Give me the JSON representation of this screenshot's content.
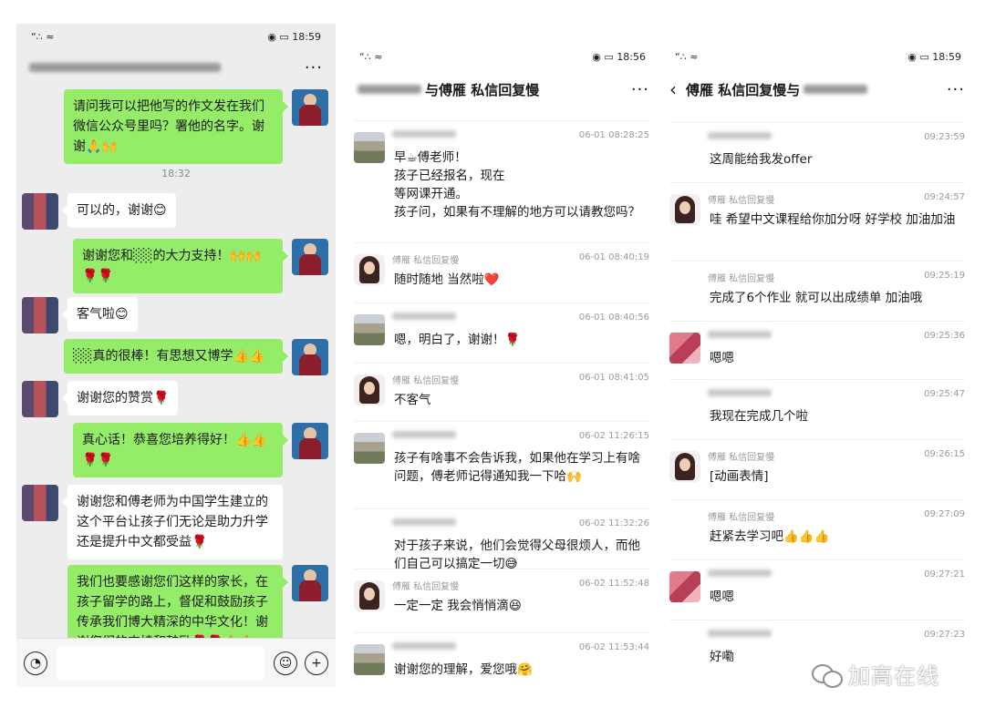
{
  "panel1": {
    "status_time": "18:59",
    "status_icons": "◉ ▭",
    "signal": "“∴ ≈",
    "more": "···",
    "time_divider": "18:32",
    "messages": [
      {
        "side": "right",
        "text": "请问我可以把他写的作文发在我们微信公众号里吗？署他的名字。谢谢🙏🙌"
      },
      {
        "side": "left",
        "text": "可以的，谢谢😊"
      },
      {
        "side": "right",
        "text": "谢谢您和░░的大力支持！🙌🙌🌹🌹"
      },
      {
        "side": "left",
        "text": "客气啦😊"
      },
      {
        "side": "right",
        "text": "░░真的很棒！有思想又博学👍👍"
      },
      {
        "side": "left",
        "text": "谢谢您的赞赏🌹"
      },
      {
        "side": "right",
        "text": "真心话！恭喜您培养得好！👍👍🌹🌹"
      },
      {
        "side": "left",
        "text": "谢谢您和傅老师为中国学生建立的这个平台让孩子们无论是助力升学还是提升中文都受益🌹"
      },
      {
        "side": "right",
        "text": "我们也要感谢您们这样的家长，在孩子留学的路上，督促和鼓励孩子传承我们博大精深的中华文化！谢谢您们的支持和鼓励🌹🌹🙏🙏"
      }
    ],
    "voice_icon": "◔",
    "emoji_icon": "☺",
    "plus_icon": "+"
  },
  "panel2": {
    "status_time": "18:56",
    "title": "与傅雁 私信回复慢",
    "more": "···",
    "messages": [
      {
        "avatar": "house",
        "sender": "",
        "time": "06-01 08:28:25",
        "text": "早☕傅老师！\n孩子已经报名，现在\n等网课开通。\n孩子问，如果有不理解的地方可以请教您吗？"
      },
      {
        "avatar": "woman",
        "sender": "傅雁 私信回复慢",
        "time": "06-01 08:40:19",
        "text": "随时随地 当然啦❤️"
      },
      {
        "avatar": "house",
        "sender": "",
        "time": "06-01 08:40:56",
        "text": "嗯，明白了，谢谢！🌹"
      },
      {
        "avatar": "woman",
        "sender": "傅雁 私信回复慢",
        "time": "06-01 08:41:05",
        "text": "不客气"
      },
      {
        "avatar": "house",
        "sender": "",
        "time": "06-02 11:26:15",
        "text": "孩子有啥事不会告诉我，如果他在学习上有啥问题，傅老师记得通知我一下哈🙌"
      },
      {
        "avatar": "none",
        "sender": "",
        "time": "06-02 11:32:26",
        "text": "对于孩子来说，他们会觉得父母很烦人，而他们自己可以搞定一切😅"
      },
      {
        "avatar": "woman",
        "sender": "傅雁 私信回复慢",
        "time": "06-02 11:52:48",
        "text": "一定一定 我会悄悄滴😆"
      },
      {
        "avatar": "house",
        "sender": "",
        "time": "06-02 11:53:44",
        "text": "谢谢您的理解，爱您哦🤗"
      }
    ]
  },
  "panel3": {
    "status_time": "18:59",
    "title": "傅雁 私信回复慢与",
    "back": "‹",
    "more": "···",
    "messages": [
      {
        "avatar": "none",
        "sender": "",
        "time": "09:23:59",
        "text": "这周能给我发offer"
      },
      {
        "avatar": "woman",
        "sender": "傅雁 私信回复慢",
        "time": "09:24:57",
        "text": "哇 希望中文课程给你加分呀 好学校 加油加油"
      },
      {
        "avatar": "none",
        "sender": "傅雁 私信回复慢",
        "time": "09:25:19",
        "text": "完成了6个作业 就可以出成绩单 加油哦"
      },
      {
        "avatar": "pink",
        "sender": "",
        "time": "09:25:36",
        "text": "嗯嗯"
      },
      {
        "avatar": "none",
        "sender": "",
        "time": "09:25:47",
        "text": "我现在完成几个啦"
      },
      {
        "avatar": "woman",
        "sender": "傅雁 私信回复慢",
        "time": "09:26:15",
        "text": "[动画表情]"
      },
      {
        "avatar": "none",
        "sender": "傅雁 私信回复慢",
        "time": "09:27:09",
        "text": "赶紧去学习吧👍👍👍"
      },
      {
        "avatar": "pink",
        "sender": "",
        "time": "09:27:21",
        "text": "嗯嗯"
      },
      {
        "avatar": "none",
        "sender": "",
        "time": "09:27:23",
        "text": "好嘞"
      }
    ]
  },
  "watermark": "加高在线"
}
